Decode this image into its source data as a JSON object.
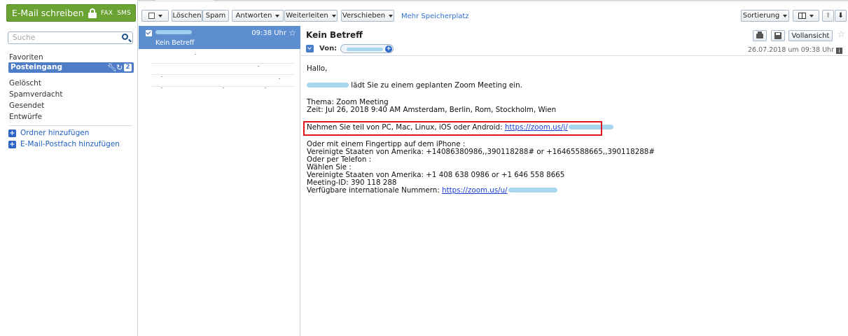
{
  "sidebar": {
    "compose_label": "E-Mail schreiben",
    "fax_label": "FAX",
    "sms_label": "SMS",
    "search_placeholder": "Suche",
    "folders": {
      "favorites": "Favoriten",
      "inbox": "Posteingang",
      "inbox_badge": "2",
      "deleted": "Gelöscht",
      "spam": "Spamverdacht",
      "sent": "Gesendet",
      "drafts": "Entwürfe"
    },
    "add_folder": "Ordner hinzufügen",
    "add_mailbox": "E-Mail-Postfach hinzufügen"
  },
  "toolbar": {
    "delete": "Löschen",
    "spam": "Spam",
    "reply": "Antworten",
    "forward": "Weiterleiten",
    "move": "Verschieben",
    "more_storage": "Mehr Speicherplatz",
    "sort": "Sortierung"
  },
  "message_list": {
    "selected": {
      "time": "09:38 Uhr",
      "subject": "Kein Betreff"
    }
  },
  "reading_pane": {
    "subject": "Kein Betreff",
    "from_label": "Von:",
    "full_view": "Vollansicht",
    "date": "26.07.2018 um 09:38 Uhr",
    "body": {
      "greeting": "Hallo,",
      "invite": "lädt Sie zu einem geplanten Zoom Meeting ein.",
      "topic": "Thema: Zoom Meeting",
      "time": "Zeit: Jul 26, 2018 9:40 AM Amsterdam, Berlin, Rom, Stockholm, Wien",
      "join_text": "Nehmen Sie teil von PC, Mac, Linux, iOS oder Android:",
      "join_link": "https://zoom.us/j/",
      "iphone": "Oder mit einem Fingertipp auf dem iPhone :",
      "iphone_numbers": "Vereinigte Staaten von Amerika: +14086380986,,390118288# or +16465588665,,390118288#",
      "phone": "Oder per Telefon :",
      "dial": "Wählen Sie :",
      "us_numbers": "Vereinigte Staaten von Amerika: +1 408 638 0986 or +1 646 558 8665",
      "meeting_id": "Meeting-ID: 390 118 288",
      "intl_label": "Verfügbare internationale Nummern:",
      "intl_link": "https://zoom.us/u/"
    }
  },
  "colors": {
    "compose_green": "#6aa334",
    "inbox_blue": "#4f7cc6",
    "selected_row": "#5d8ed0",
    "highlight_red": "#e0161f",
    "link_blue": "#1a3fd6"
  }
}
